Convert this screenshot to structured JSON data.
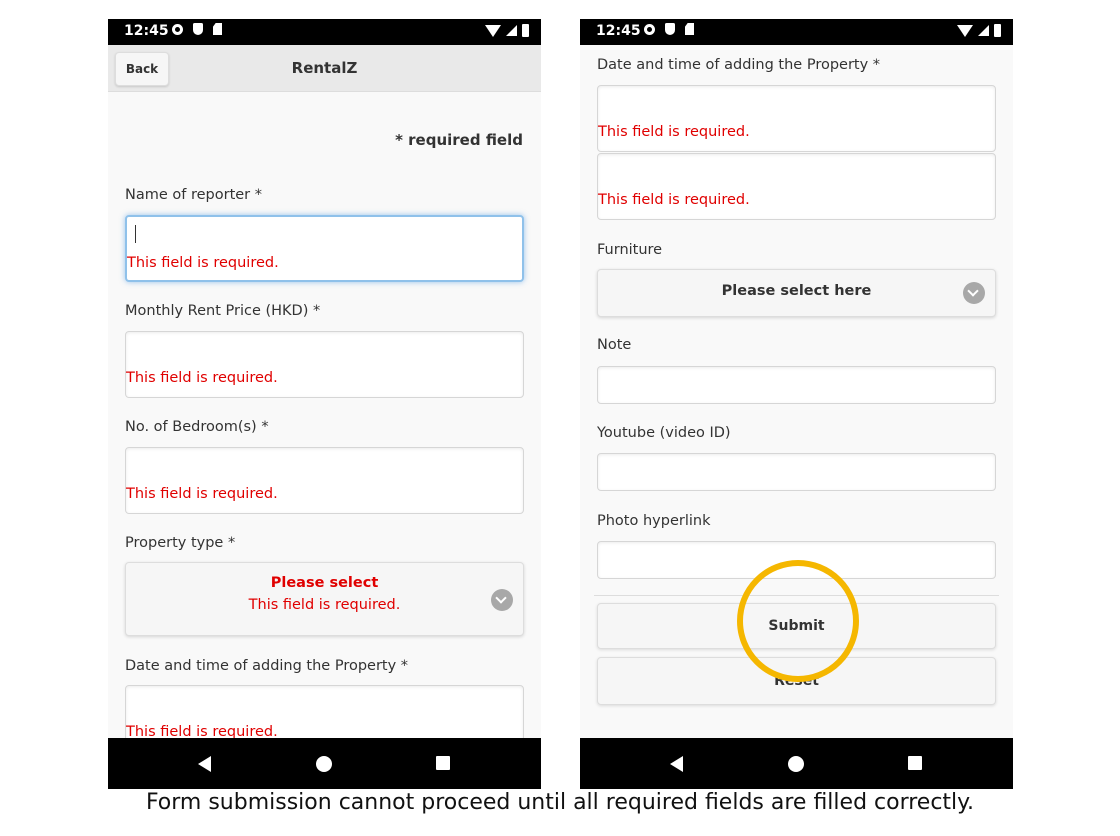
{
  "status_bar": {
    "time": "12:45"
  },
  "header": {
    "back_label": "Back",
    "title": "RentalZ"
  },
  "left_form": {
    "required_note": "* required field",
    "reporter_label": "Name of reporter *",
    "rent_label": "Monthly Rent Price (HKD) *",
    "bedroom_label": "No. of Bedroom(s) *",
    "property_type_label": "Property type *",
    "property_type_value": "Please select",
    "datetime_label": "Date and time of adding the Property *",
    "error_text": "This field is required."
  },
  "right_form": {
    "datetime_label": "Date and time of adding the Property *",
    "error_text": "This field is required.",
    "furniture_label": "Furniture",
    "furniture_value": "Please select here",
    "note_label": "Note",
    "youtube_label": "Youtube (video ID)",
    "photo_label": "Photo hyperlink",
    "submit_label": "Submit",
    "reset_label": "Reset"
  },
  "caption": "Form submission cannot proceed until all required fields are filled correctly.",
  "colors": {
    "error": "#e00000",
    "highlight": "#f5b700",
    "focus": "#8fc1ea"
  },
  "icons": [
    "settings-icon",
    "shield-icon",
    "sd-card-icon",
    "wifi-icon",
    "signal-icon",
    "battery-icon",
    "chevron-down-icon",
    "nav-back-icon",
    "nav-home-icon",
    "nav-recents-icon"
  ]
}
